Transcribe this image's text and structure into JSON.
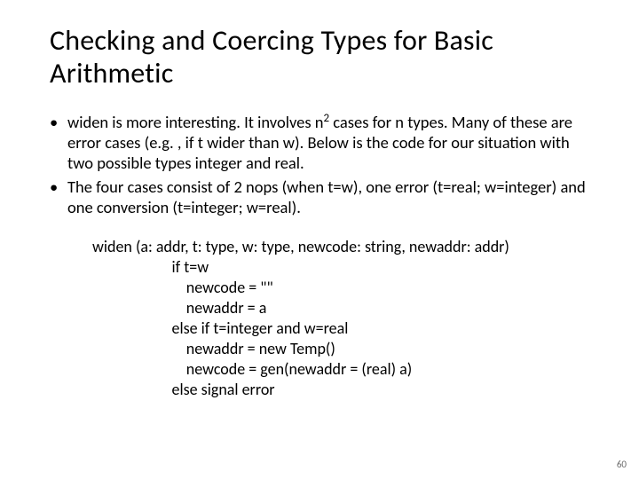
{
  "title": "Checking and Coercing Types for Basic Arithmetic",
  "bullets": [
    {
      "pre": "widen is more interesting. It involves n",
      "sup": "2",
      "post": " cases for n types. Many of these are error cases (e.g. , if t wider than w). Below is the code for our situation with two possible types integer and real."
    },
    {
      "pre": "The four cases consist of 2 nops (when t=w), one error (t=real; w=integer) and one conversion (t=integer; w=real).",
      "sup": "",
      "post": ""
    }
  ],
  "code": {
    "l1": "widen (a: addr, t: type, w: type, newcode: string, newaddr: addr)",
    "l2": "                      if t=w",
    "l3": "                          newcode = \"\"",
    "l4": "                          newaddr = a",
    "l5": "                      else if t=integer and w=real",
    "l6": "                          newaddr = new Temp()",
    "l7": "                          newcode = gen(newaddr = (real) a)",
    "l8": "                      else signal error"
  },
  "pageNumber": "60",
  "dot": "•"
}
